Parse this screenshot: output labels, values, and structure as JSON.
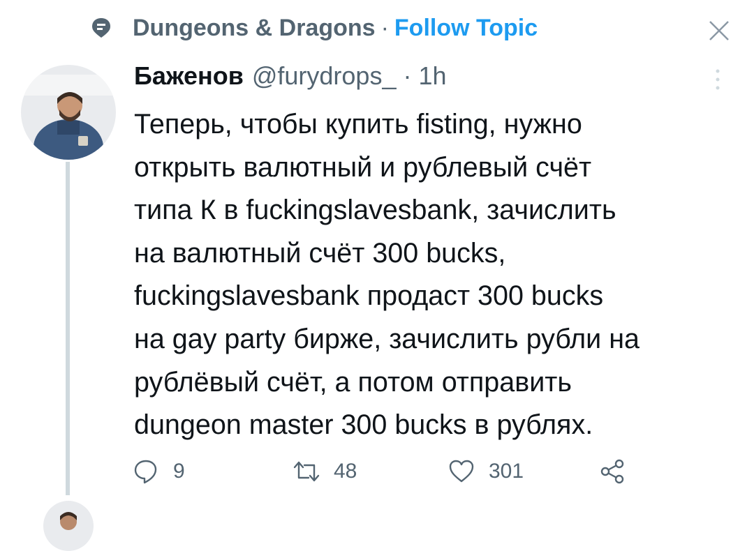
{
  "topic": {
    "name": "Dungeons & Dragons",
    "separator": "·",
    "follow_label": "Follow Topic"
  },
  "tweet": {
    "display_name": "Баженов",
    "handle": "@furydrops_",
    "dot": "·",
    "time": "1h",
    "text_lines": [
      "Теперь, чтобы купить fisting, нужно",
      "открыть валютный и рублевый счёт",
      "типа К в fuckingslavesbank, зачислить",
      "на валютный счёт 300 bucks,",
      "fuckingslavesbank продаст 300 bucks",
      "на gay party бирже, зачислить рубли на",
      "рублёвый счёт, а потом отправить",
      "dungeon master 300 bucks в рублях."
    ],
    "actions": {
      "replies": "9",
      "retweets": "48",
      "likes": "301"
    }
  },
  "colors": {
    "text_primary": "#0f1419",
    "text_secondary": "#536471",
    "accent": "#1d9bf0",
    "thread_line": "#cfd9de"
  },
  "icons": [
    "topic-icon",
    "close-icon",
    "more-icon",
    "reply-icon",
    "retweet-icon",
    "like-icon",
    "share-icon"
  ]
}
